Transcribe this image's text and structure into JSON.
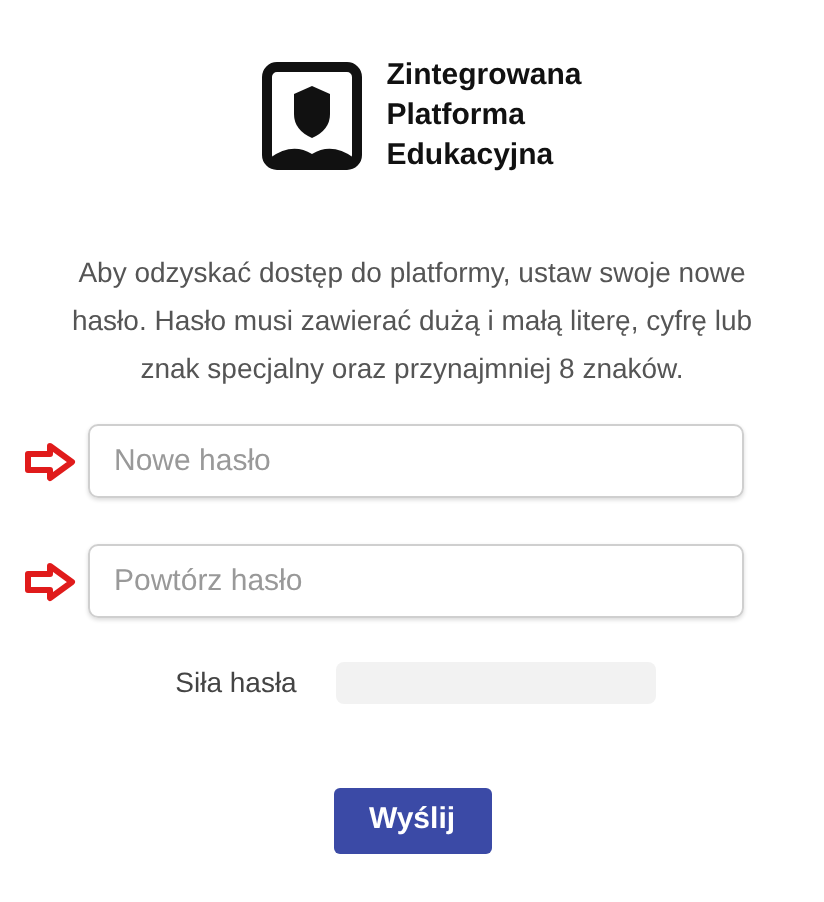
{
  "logo": {
    "lines": [
      "Zintegrowana",
      "Platforma",
      "Edukacyjna"
    ]
  },
  "instructions": "Aby odzyskać dostęp do platformy, ustaw swoje nowe hasło. Hasło musi zawierać dużą i małą literę, cyfrę lub znak specjalny oraz przynajmniej 8 znaków.",
  "fields": [
    {
      "placeholder": "Nowe hasło",
      "marked": true
    },
    {
      "placeholder": "Powtórz hasło",
      "marked": true
    }
  ],
  "strength": {
    "label": "Siła hasła",
    "level": 0
  },
  "submit_button": "Wyślij"
}
